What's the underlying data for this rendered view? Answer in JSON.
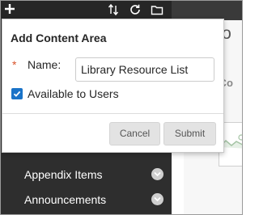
{
  "menu": {
    "items": [
      {
        "label": "Appendix Items"
      },
      {
        "label": "Announcements"
      }
    ]
  },
  "content": {
    "title_fragment": "Co",
    "subtitle_fragment": "d Co"
  },
  "modal": {
    "title": "Add Content Area",
    "required_mark": "*",
    "name_label": "Name:",
    "name_value": "Library Resource List",
    "checkbox_label": "Available to Users",
    "checkbox_checked": true,
    "cancel_label": "Cancel",
    "submit_label": "Submit"
  },
  "icons": {
    "add": "plus-icon",
    "sort": "sort-arrows-icon",
    "refresh": "refresh-icon",
    "folder": "folder-icon",
    "chevron": "chevron-down-circle-icon"
  },
  "colors": {
    "menu_bg": "#2e2e2e",
    "required": "#d9532b",
    "checkbox": "#1a73c8",
    "button_bg": "#e3e3e3"
  }
}
